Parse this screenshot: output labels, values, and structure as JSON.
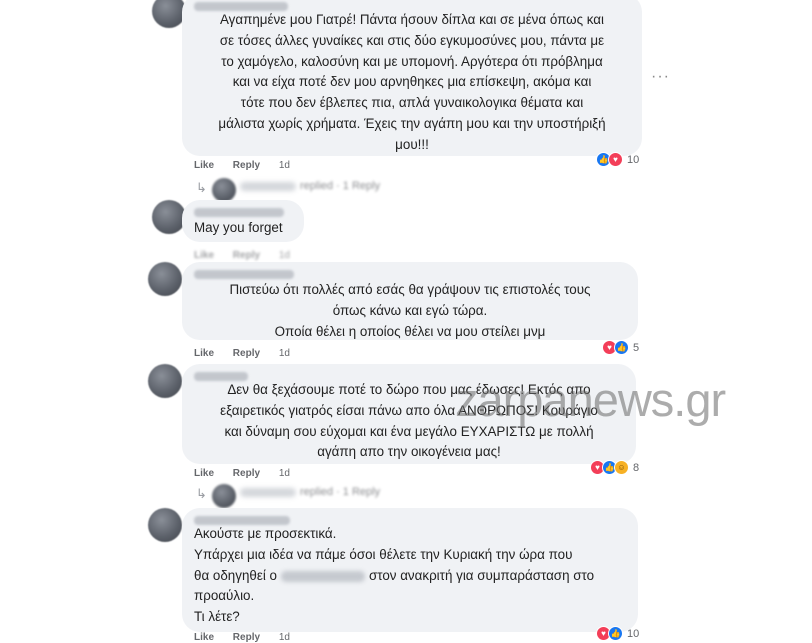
{
  "comments": [
    {
      "lines": [
        "Αγαπημένε μου Γιατρέ! Πάντα ήσουν δίπλα και σε μένα όπως και",
        "σε τόσες άλλες γυναίκες και στις δύο εγκυμοσύνες μου, πάντα με",
        "το χαμόγελο, καλοσύνη και με υπομονή. Αργότερα ότι πρόβλημα",
        "και να είχα ποτέ δεν μου αρνηθηκες μια επίσκεψη, ακόμα και",
        "τότε που δεν έβλεπες πια, απλά γυναικολογικα θέματα και",
        "μάλιστα χωρίς χρήματα. Έχεις την αγάπη μου και την υποστήριξή",
        "μου!!!"
      ],
      "like": "Like",
      "reply": "Reply",
      "time": "1d",
      "reaction_count": "10",
      "replies_text": "replied · 1 Reply"
    },
    {
      "lines": [
        "May you forget"
      ],
      "like": "Like",
      "reply": "Reply",
      "time": "1d"
    },
    {
      "lines": [
        "Πιστεύω ότι πολλές από εσάς θα γράψουν τις επιστολές τους",
        "όπως κάνω και εγώ τώρα.",
        "Οποία θέλει η οποίος θέλει να μου στείλει μνμ"
      ],
      "like": "Like",
      "reply": "Reply",
      "time": "1d",
      "reaction_count": "5"
    },
    {
      "lines": [
        "Δεν θα ξεχάσουμε ποτέ το δώρο που μας έδωσες! Εκτός απο",
        "εξαιρετικός γιατρός είσαι πάνω απο όλα ΑΝΘΡΩΠΟΣ! Κουράγιο",
        "και δύναμη σου εύχομαι και ένα μεγάλο ΕΥΧΑΡΙΣΤΩ με πολλή",
        "αγάπη απο την οικογένεια μας!"
      ],
      "like": "Like",
      "reply": "Reply",
      "time": "1d",
      "reaction_count": "8",
      "replies_text": "replied · 1 Reply"
    },
    {
      "lines": [
        "Ακούστε με προσεκτικά.",
        "Υπάρχει μια ιδέα να πάμε όσοι θέλετε την Κυριακή την ώρα που",
        "θα οδηγηθεί ο",
        "στον ανακριτή για συμπαράσταση στο",
        "προαύλιο.",
        "Τι λέτε?"
      ],
      "like": "Like",
      "reply": "Reply",
      "time": "1d",
      "reaction_count": "10"
    }
  ],
  "watermark": "zarpanews.gr",
  "icons": {
    "like": "like-icon",
    "love": "love-icon",
    "haha": "haha-icon",
    "more": "more-options-icon",
    "reply_arrow": "reply-arrow-icon"
  },
  "colors": {
    "bubble": "#f0f2f5",
    "like": "#1877f2",
    "love": "#f33e58",
    "haha": "#f7b125"
  }
}
